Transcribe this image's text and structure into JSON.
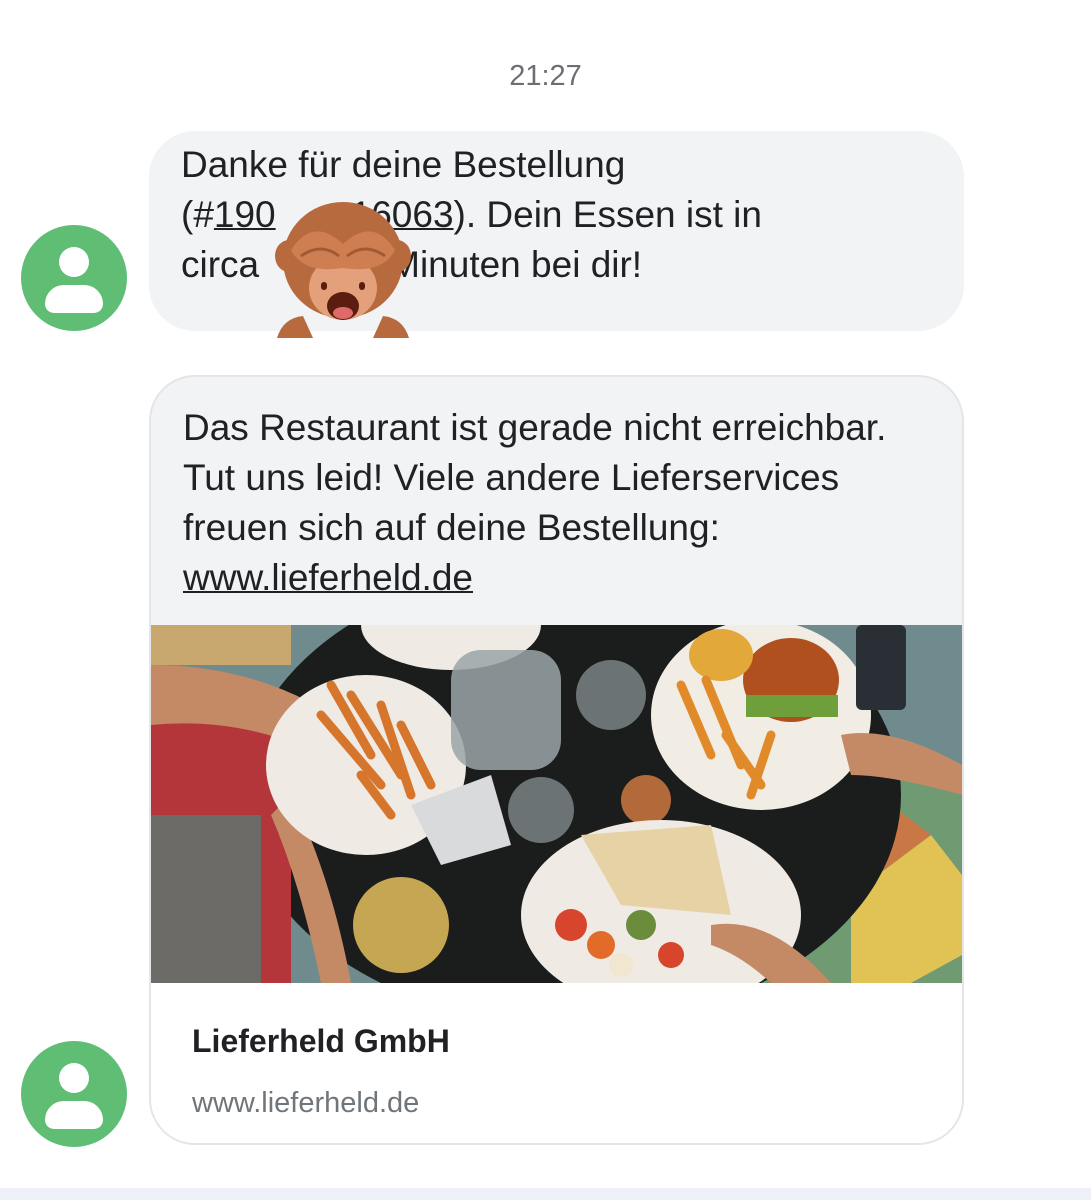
{
  "timestamp": "21:27",
  "sender_avatar_icon": "person-icon",
  "messages": [
    {
      "line1": "Danke für deine Bestellung",
      "line2_prefix": "(#",
      "line2_order_a": "190",
      "line2_order_b": "16063",
      "line2_suffix": "). Dein Essen ist in",
      "line3_prefix": "circa",
      "line3_suffix": "Minuten bei dir!",
      "redaction_icon": "see-no-evil-monkey-icon"
    },
    {
      "text": "Das Restaurant ist gerade nicht erreichbar. Tut uns leid! Viele andere Lieferservices freuen sich auf deine Bestellung: ",
      "link": "www.lieferheld.de",
      "preview": {
        "image_icon": "food-table-photo",
        "title": "Lieferheld GmbH",
        "url": "www.lieferheld.de"
      }
    }
  ],
  "colors": {
    "avatar": "#5fbe73",
    "bubble": "#f1f3f4",
    "text": "#202124",
    "muted": "#70757a"
  }
}
